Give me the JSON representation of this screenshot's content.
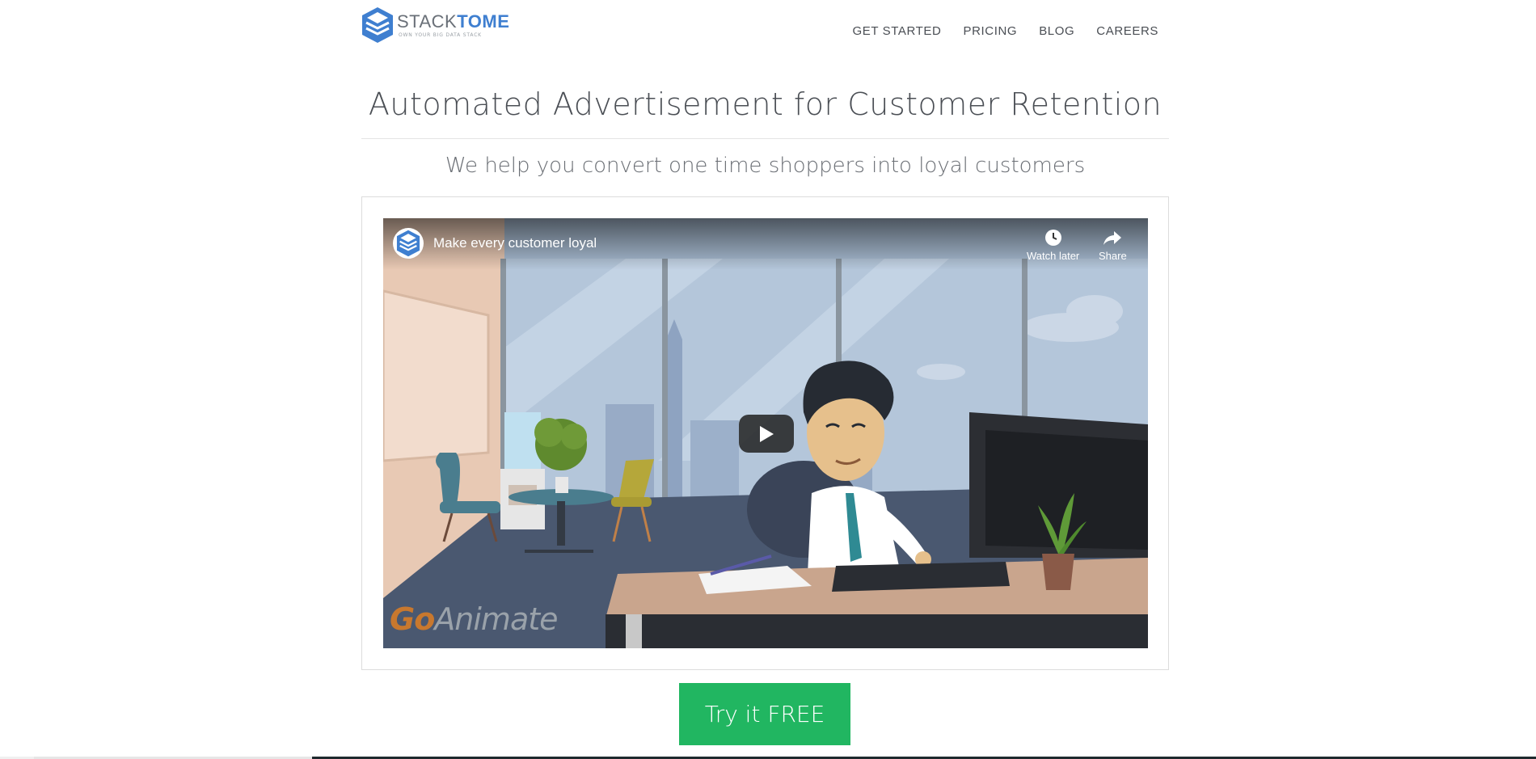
{
  "header": {
    "logo": {
      "word_part1": "STACK",
      "word_part2": "TOME",
      "tagline": "OWN YOUR BIG DATA STACK",
      "brand_color": "#3f7fd0"
    },
    "nav": [
      {
        "label": "GET STARTED"
      },
      {
        "label": "PRICING"
      },
      {
        "label": "BLOG"
      },
      {
        "label": "CAREERS"
      }
    ]
  },
  "hero": {
    "headline": "Automated Advertisement for Customer Retention",
    "subheadline": "We help you convert one time shoppers into loyal customers"
  },
  "video": {
    "title": "Make every customer loyal",
    "channel_icon": "stacktome-logo-icon",
    "actions": [
      {
        "label": "Watch later",
        "icon": "clock-icon"
      },
      {
        "label": "Share",
        "icon": "share-icon"
      }
    ],
    "play_icon": "play-icon",
    "watermark_part1": "Go",
    "watermark_part2": "Animate"
  },
  "cta": {
    "label": "Try it FREE",
    "color": "#21b661"
  }
}
